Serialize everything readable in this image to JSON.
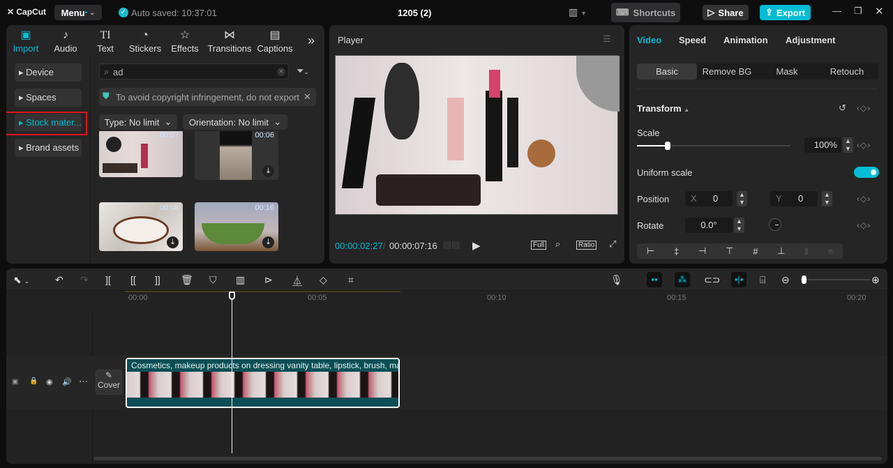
{
  "app": {
    "logo": "CapCut",
    "menu": "Menu",
    "autosave": "Auto saved: 10:37:01",
    "project_title": "1205 (2)",
    "shortcuts": "Shortcuts",
    "share": "Share",
    "export": "Export",
    "accent": "#00bcd4"
  },
  "media_tabs": [
    {
      "label": "Import",
      "icon": "import-icon"
    },
    {
      "label": "Audio",
      "icon": "audio-icon"
    },
    {
      "label": "Text",
      "icon": "text-icon"
    },
    {
      "label": "Stickers",
      "icon": "stickers-icon"
    },
    {
      "label": "Effects",
      "icon": "effects-icon"
    },
    {
      "label": "Transitions",
      "icon": "transitions-icon"
    },
    {
      "label": "Captions",
      "icon": "captions-icon"
    }
  ],
  "sidebar": [
    {
      "label": "Device"
    },
    {
      "label": "Spaces"
    },
    {
      "label": "Stock mater..."
    },
    {
      "label": "Brand assets"
    }
  ],
  "search": {
    "value": "ad"
  },
  "notice": "To avoid copyright infringement, do not export",
  "filters": {
    "type": "Type: No limit",
    "orientation": "Orientation: No limit"
  },
  "thumbs": [
    {
      "duration": "00:07"
    },
    {
      "duration": "00:06"
    },
    {
      "duration": "00:08"
    },
    {
      "duration": "00:16"
    }
  ],
  "player": {
    "title": "Player",
    "current": "00:00:02:27",
    "total": "00:00:07:16",
    "full": "Full",
    "ratio": "Ratio"
  },
  "inspector": {
    "tabs": [
      "Video",
      "Speed",
      "Animation",
      "Adjustment"
    ],
    "subtabs": [
      "Basic",
      "Remove BG",
      "Mask",
      "Retouch"
    ],
    "section": "Transform",
    "scale_label": "Scale",
    "scale_value": "100%",
    "scale_fraction": 0.2,
    "uniform_label": "Uniform scale",
    "uniform_on": true,
    "position_label": "Position",
    "x_label": "X",
    "x_value": "0",
    "y_label": "Y",
    "y_value": "0",
    "rotate_label": "Rotate",
    "rotate_value": "0.0°"
  },
  "timeline": {
    "ticks": [
      "00:00",
      "00:05",
      "00:10",
      "00:15",
      "00:20"
    ],
    "clip_title": "Cosmetics, makeup products on dressing vanity table, lipstick, brush, mascara",
    "cover": "Cover"
  }
}
